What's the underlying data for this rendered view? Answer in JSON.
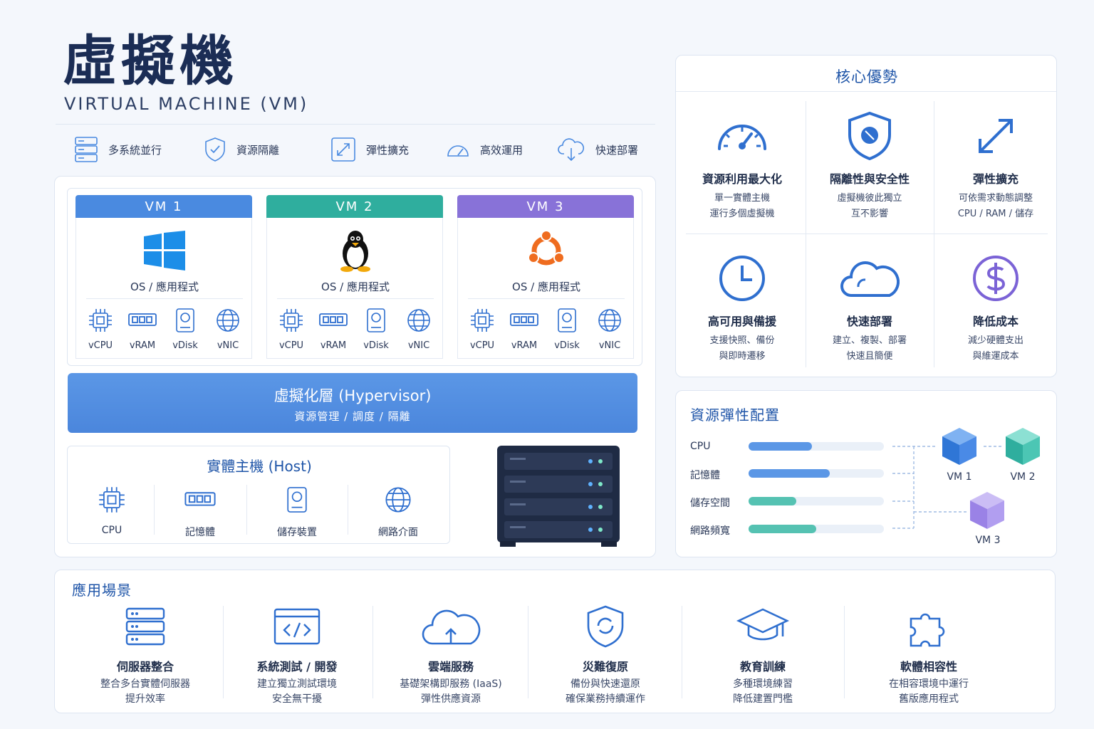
{
  "title": "虛擬機",
  "subtitle": "VIRTUAL MACHINE (VM)",
  "features": [
    {
      "label": "多系統並行",
      "icon": "server-stack-icon"
    },
    {
      "label": "資源隔離",
      "icon": "shield-check-icon"
    },
    {
      "label": "彈性擴充",
      "icon": "expand-icon"
    },
    {
      "label": "高效運用",
      "icon": "gauge-icon"
    },
    {
      "label": "快速部署",
      "icon": "cloud-download-icon"
    }
  ],
  "vms": [
    {
      "name": "VM 1",
      "os_icon": "windows-logo-icon",
      "color": "#4a8ae0",
      "os_label": "OS / 應用程式"
    },
    {
      "name": "VM 2",
      "os_icon": "linux-penguin-icon",
      "color": "#2fae9e",
      "os_label": "OS / 應用程式"
    },
    {
      "name": "VM 3",
      "os_icon": "ubuntu-logo-icon",
      "color": "#8872d8",
      "os_label": "OS / 應用程式"
    }
  ],
  "vm_resources": [
    "vCPU",
    "vRAM",
    "vDisk",
    "vNIC"
  ],
  "hypervisor": {
    "title": "虛擬化層 (Hypervisor)",
    "subtitle": "資源管理 / 調度 / 隔離"
  },
  "host": {
    "title": "實體主機 (Host)",
    "resources": [
      "CPU",
      "記憶體",
      "儲存裝置",
      "網路介面"
    ]
  },
  "advantages": {
    "title": "核心優勢",
    "items": [
      {
        "title": "資源利用最大化",
        "desc": [
          "單一實體主機",
          "運行多個虛擬機"
        ],
        "icon": "speedometer-icon"
      },
      {
        "title": "隔離性與安全性",
        "desc": [
          "虛擬機彼此獨立",
          "互不影響"
        ],
        "icon": "shield-icon"
      },
      {
        "title": "彈性擴充",
        "desc": [
          "可依需求動態調整",
          "CPU / RAM / 儲存"
        ],
        "icon": "expand-arrows-icon"
      },
      {
        "title": "高可用與備援",
        "desc": [
          "支援快照、備份",
          "與即時遷移"
        ],
        "icon": "clock-icon"
      },
      {
        "title": "快速部署",
        "desc": [
          "建立、複製、部署",
          "快速且簡便"
        ],
        "icon": "cloud-icon"
      },
      {
        "title": "降低成本",
        "desc": [
          "減少硬體支出",
          "與維運成本"
        ],
        "icon": "dollar-icon"
      }
    ]
  },
  "resource_allocation": {
    "title": "資源彈性配置",
    "bars": [
      {
        "label": "CPU",
        "fraction": 0.47,
        "color": "#5b97e6"
      },
      {
        "label": "記憶體",
        "fraction": 0.6,
        "color": "#5b97e6"
      },
      {
        "label": "儲存空間",
        "fraction": 0.35,
        "color": "#55c2b2"
      },
      {
        "label": "網路頻寬",
        "fraction": 0.5,
        "color": "#55c2b2"
      }
    ],
    "vms": [
      {
        "label": "VM 1",
        "color": "#3f86e0"
      },
      {
        "label": "VM 2",
        "color": "#3fbfae"
      },
      {
        "label": "VM 3",
        "color": "#a48ee8"
      }
    ]
  },
  "applications": {
    "title": "應用場景",
    "items": [
      {
        "title": "伺服器整合",
        "desc": [
          "整合多台實體伺服器",
          "提升效率"
        ],
        "icon": "server-rack-icon"
      },
      {
        "title": "系統測試 / 開發",
        "desc": [
          "建立獨立測試環境",
          "安全無干擾"
        ],
        "icon": "code-window-icon"
      },
      {
        "title": "雲端服務",
        "desc": [
          "基礎架構即服務 (IaaS)",
          "彈性供應資源"
        ],
        "icon": "cloud-upload-icon"
      },
      {
        "title": "災難復原",
        "desc": [
          "備份與快速還原",
          "確保業務持續運作"
        ],
        "icon": "shield-recovery-icon"
      },
      {
        "title": "教育訓練",
        "desc": [
          "多種環境練習",
          "降低建置門檻"
        ],
        "icon": "graduation-cap-icon"
      },
      {
        "title": "軟體相容性",
        "desc": [
          "在相容環境中運行",
          "舊版應用程式"
        ],
        "icon": "puzzle-icon"
      }
    ]
  }
}
